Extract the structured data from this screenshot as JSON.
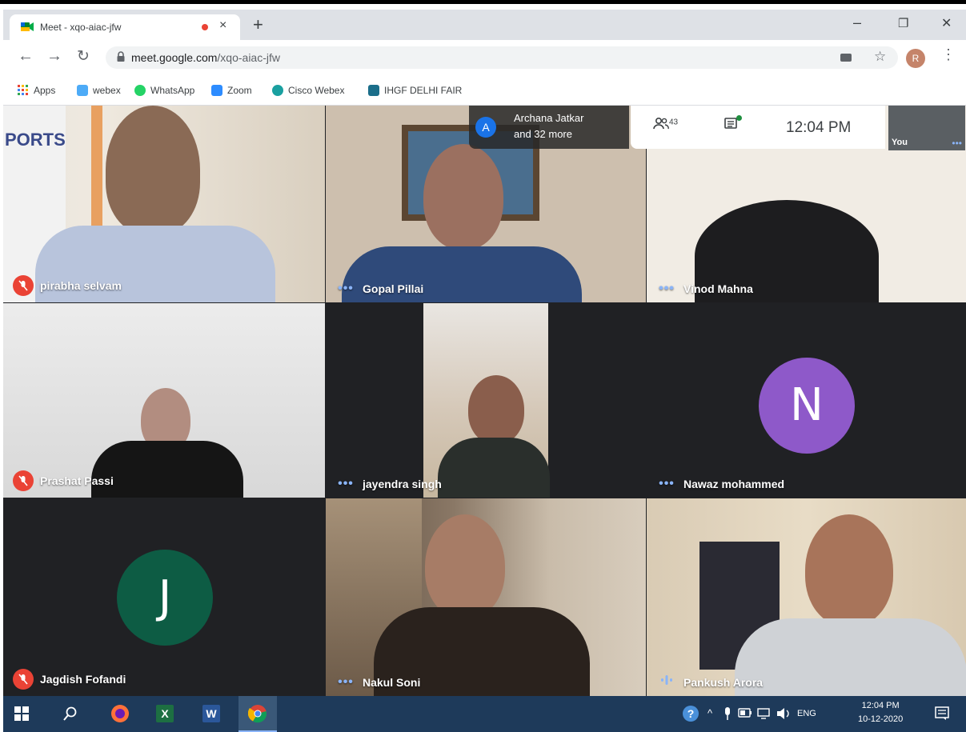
{
  "browser": {
    "tab_title": "Meet - xqo-aiac-jfw",
    "tab_close": "×",
    "new_tab": "+",
    "minimize": "–",
    "restore": "❐",
    "close": "✕",
    "url_domain": "meet.google.com",
    "url_path": "/xqo-aiac-jfw",
    "profile_initial": "R"
  },
  "bookmarks": [
    {
      "label": "Apps",
      "icon": "apps-grid-icon",
      "color": "#ea4335"
    },
    {
      "label": "webex",
      "icon": "webex-icon",
      "color": "#4dabf7"
    },
    {
      "label": "WhatsApp",
      "icon": "whatsapp-icon",
      "color": "#25d366"
    },
    {
      "label": "Zoom",
      "icon": "zoom-icon",
      "color": "#2d8cff"
    },
    {
      "label": "Cisco Webex",
      "icon": "cisco-webex-icon",
      "color": "#1aa0a0"
    },
    {
      "label": "IHGF DELHI FAIR",
      "icon": "ihgf-icon",
      "color": "#1b6e8a"
    }
  ],
  "meet": {
    "join_notice_initial": "A",
    "join_notice_line1": "Archana Jatkar",
    "join_notice_line2": "and 32 more",
    "participant_count": "43",
    "time": "12:04 PM",
    "self_label": "You",
    "participants": [
      {
        "name": "pirabha selvam",
        "status": "muted"
      },
      {
        "name": "Gopal Pillai",
        "status": "active"
      },
      {
        "name": "Vinod Mahna",
        "status": "active"
      },
      {
        "name": "Prashat Passi",
        "status": "muted"
      },
      {
        "name": "jayendra singh",
        "status": "active"
      },
      {
        "name": "Nawaz mohammed",
        "status": "active",
        "avatar_letter": "N",
        "avatar_color": "#8e59c9"
      },
      {
        "name": "Jagdish Fofandi",
        "status": "muted",
        "avatar_letter": "J",
        "avatar_color": "#0d5c44"
      },
      {
        "name": "Nakul Soni",
        "status": "active"
      },
      {
        "name": "Pankush Arora",
        "status": "speaking"
      }
    ],
    "wall_sign_text": "PORTS"
  },
  "taskbar": {
    "language": "ENG",
    "time": "12:04 PM",
    "date": "10-12-2020"
  }
}
